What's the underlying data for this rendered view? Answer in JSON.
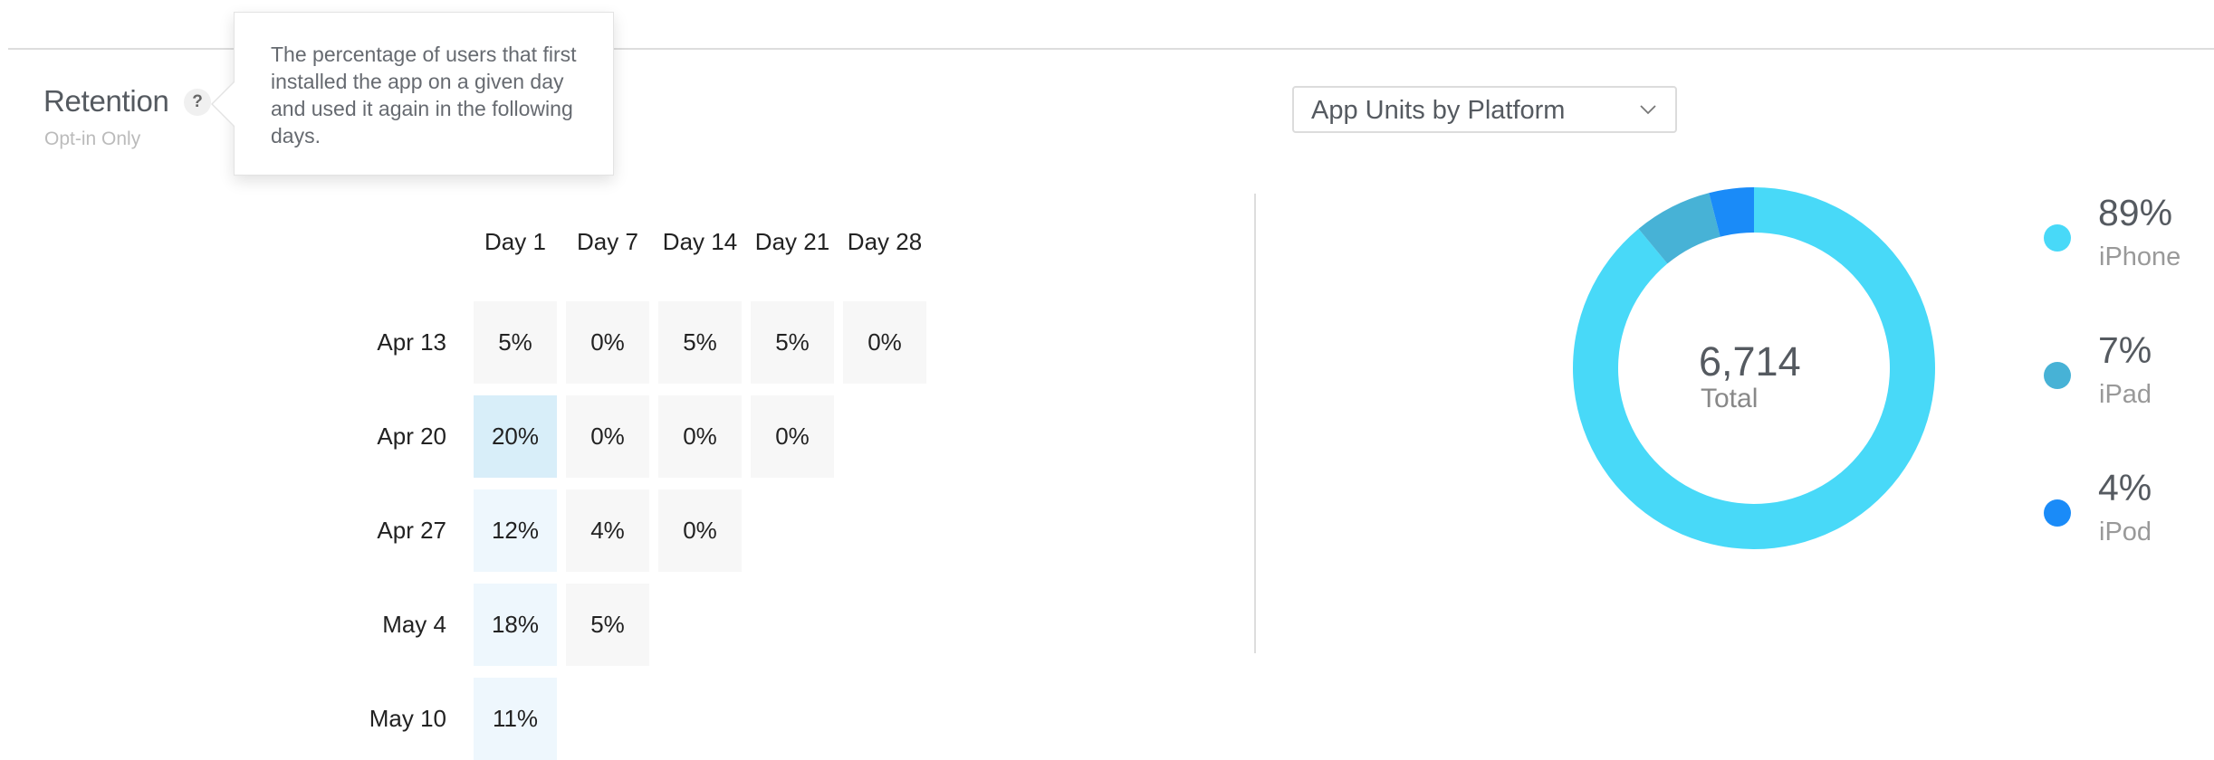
{
  "retention": {
    "title": "Retention",
    "subtitle": "Opt-in Only",
    "help_icon": "question-mark-icon",
    "help_symbol": "?",
    "tooltip": "The percentage of users that first installed the app on a given day and used it again in the following days.",
    "columns": [
      "Day 1",
      "Day 7",
      "Day 14",
      "Day 21",
      "Day 28"
    ],
    "rows": [
      {
        "label": "Apr 13",
        "values": [
          "5%",
          "0%",
          "5%",
          "5%",
          "0%"
        ],
        "levels": [
          0,
          0,
          0,
          0,
          0
        ]
      },
      {
        "label": "Apr 20",
        "values": [
          "20%",
          "0%",
          "0%",
          "0%"
        ],
        "levels": [
          2,
          0,
          0,
          0
        ]
      },
      {
        "label": "Apr 27",
        "values": [
          "12%",
          "4%",
          "0%"
        ],
        "levels": [
          1,
          0,
          0
        ]
      },
      {
        "label": "May 4",
        "values": [
          "18%",
          "5%"
        ],
        "levels": [
          1,
          0
        ]
      },
      {
        "label": "May 10",
        "values": [
          "11%"
        ],
        "levels": [
          1
        ]
      }
    ],
    "heat_colors": [
      "#f7f7f7",
      "#eef7fd",
      "#d8eef9"
    ]
  },
  "platform": {
    "dropdown_label": "App Units by Platform",
    "dropdown_icon": "chevron-down-icon",
    "total_value": "6,714",
    "total_label": "Total"
  },
  "chart_data": {
    "type": "pie",
    "variant": "donut",
    "title": "App Units by Platform",
    "center_value": "6,714",
    "center_label": "Total",
    "start_angle": "12 o'clock, clockwise",
    "legend_position": "right",
    "slices": [
      {
        "name": "iPhone",
        "value": 89,
        "label": "89%",
        "color": "#48d9f8"
      },
      {
        "name": "iPad",
        "value": 7,
        "label": "7%",
        "color": "#47b2d6"
      },
      {
        "name": "iPod",
        "value": 4,
        "label": "4%",
        "color": "#1a8bf8"
      }
    ]
  }
}
